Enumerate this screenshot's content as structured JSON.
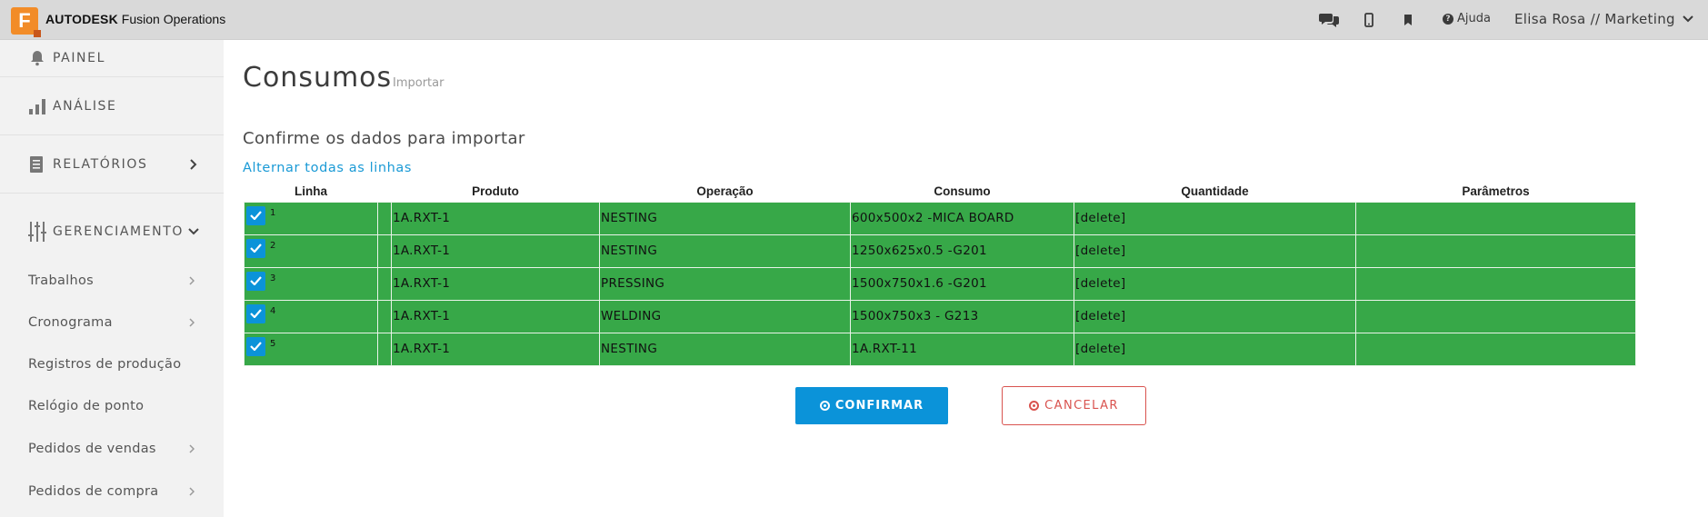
{
  "topbar": {
    "logo_letter": "F",
    "brand_strong": "AUTODESK",
    "brand_rest": "Fusion Operations",
    "icons": [
      "chat-icon",
      "mobile-icon",
      "bookmark-icon"
    ],
    "help_label": "Ajuda",
    "user_label": "Elisa Rosa // Marketing"
  },
  "sidebar": {
    "main": [
      {
        "label": "PAINEL",
        "icon": "bell-icon"
      },
      {
        "label": "ANÁLISE",
        "icon": "bar-chart-icon"
      },
      {
        "label": "RELATÓRIOS",
        "icon": "report-icon"
      },
      {
        "label": "GERENCIAMENTO",
        "icon": "sliders-icon"
      }
    ],
    "sub": [
      {
        "label": "Trabalhos"
      },
      {
        "label": "Cronograma"
      },
      {
        "label": "Registros de produção"
      },
      {
        "label": "Relógio de ponto"
      },
      {
        "label": "Pedidos de vendas"
      },
      {
        "label": "Pedidos de compra"
      }
    ]
  },
  "main": {
    "title": "Consumos",
    "subtitle": "Importar",
    "section_title": "Confirme os dados para importar",
    "toggle_all": "Alternar todas as linhas",
    "columns": [
      "Linha",
      "Produto",
      "Operação",
      "Consumo",
      "Quantidade",
      "Parâmetros"
    ],
    "rows": [
      {
        "num": "1",
        "produto": "1A.RXT-1",
        "operacao": "NESTING",
        "consumo": "600x500x2 -MICA BOARD",
        "quantidade": "[delete]",
        "parametros": ""
      },
      {
        "num": "2",
        "produto": "1A.RXT-1",
        "operacao": "NESTING",
        "consumo": "1250x625x0.5 -G201",
        "quantidade": "[delete]",
        "parametros": ""
      },
      {
        "num": "3",
        "produto": "1A.RXT-1",
        "operacao": "PRESSING",
        "consumo": "1500x750x1.6 -G201",
        "quantidade": "[delete]",
        "parametros": ""
      },
      {
        "num": "4",
        "produto": "1A.RXT-1",
        "operacao": "WELDING",
        "consumo": "1500x750x3 - G213",
        "quantidade": "[delete]",
        "parametros": ""
      },
      {
        "num": "5",
        "produto": "1A.RXT-1",
        "operacao": "NESTING",
        "consumo": "1A.RXT-11",
        "quantidade": "[delete]",
        "parametros": ""
      }
    ],
    "confirm_label": "CONFIRMAR",
    "cancel_label": "CANCELAR"
  },
  "colors": {
    "row_green": "#37a848",
    "accent_blue": "#0b93d9",
    "cancel_red": "#d9534f",
    "logo_orange": "#f28c28"
  }
}
